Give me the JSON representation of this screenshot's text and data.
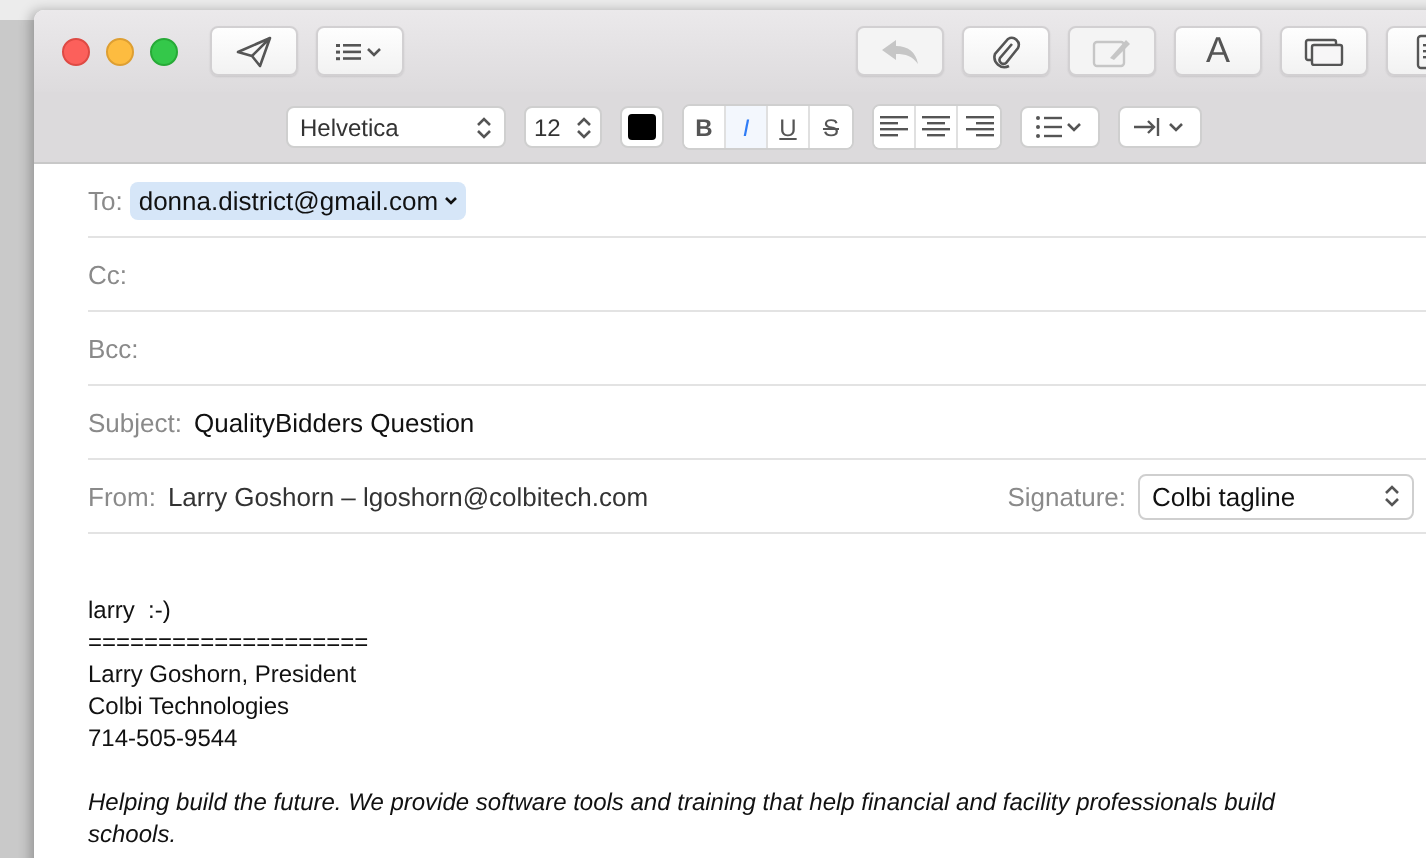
{
  "toolbar": {
    "left": [
      {
        "kind": "send",
        "disabled": false
      },
      {
        "kind": "list-menu",
        "disabled": false
      }
    ],
    "right": [
      {
        "kind": "reply",
        "disabled": true
      },
      {
        "kind": "attach",
        "disabled": false
      },
      {
        "kind": "markup",
        "disabled": true
      },
      {
        "kind": "font",
        "label": "A",
        "disabled": false
      },
      {
        "kind": "window",
        "disabled": false
      },
      {
        "kind": "notes",
        "disabled": false
      }
    ]
  },
  "format_bar": {
    "font": "Helvetica",
    "size": "12",
    "color": "#000000",
    "styles": [
      {
        "label": "B",
        "kind": "bold",
        "selected": false
      },
      {
        "label": "I",
        "kind": "italic",
        "selected": true
      },
      {
        "label": "U",
        "kind": "underline",
        "selected": false
      },
      {
        "label": "S",
        "kind": "strike",
        "selected": false
      }
    ],
    "alignment": [
      {
        "kind": "left",
        "selected": false
      },
      {
        "kind": "center",
        "selected": false
      },
      {
        "kind": "right",
        "selected": false
      }
    ]
  },
  "headers": {
    "to": {
      "label": "To:",
      "recipients": [
        "donna.district@gmail.com"
      ]
    },
    "cc": {
      "label": "Cc:"
    },
    "bcc": {
      "label": "Bcc:"
    },
    "subject": {
      "label": "Subject:",
      "value": "QualityBidders Question"
    },
    "from": {
      "label": "From:",
      "value": "Larry Goshorn – lgoshorn@colbitech.com"
    },
    "signature": {
      "label": "Signature:",
      "value": "Colbi tagline"
    }
  },
  "body": [
    {
      "kind": "text",
      "text": "larry  :-)"
    },
    {
      "kind": "text",
      "text": "===================="
    },
    {
      "kind": "text",
      "text": "Larry Goshorn, President"
    },
    {
      "kind": "text",
      "text": "Colbi Technologies"
    },
    {
      "kind": "text",
      "text": "714-505-9544"
    },
    {
      "kind": "blank"
    },
    {
      "kind": "italic",
      "text": "Helping build the future. We provide software tools and training that help financial and facility professionals build schools."
    }
  ]
}
